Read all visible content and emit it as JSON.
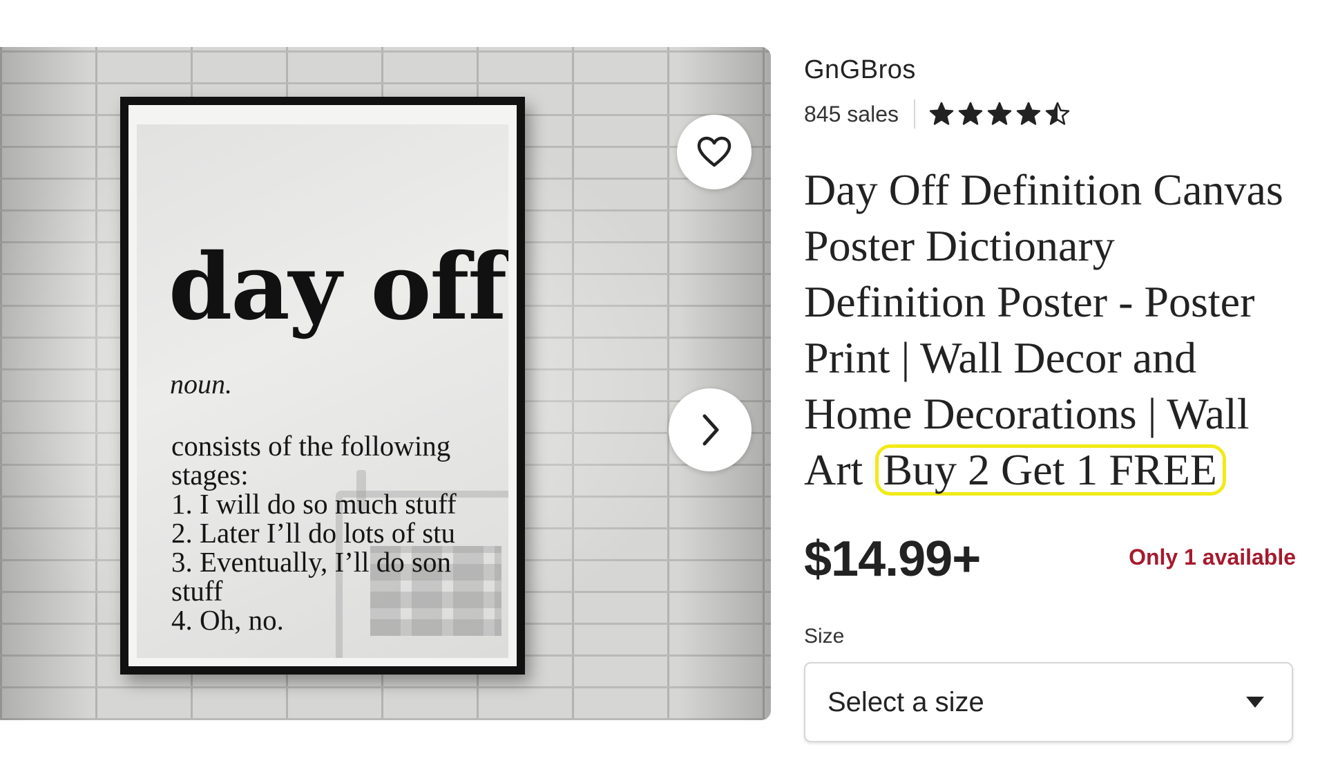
{
  "gallery": {
    "poster": {
      "headword": "day  off",
      "part_of_speech": "noun.",
      "definition_lines": [
        "consists of the following",
        "stages:",
        "1. I will do so much stuff",
        "2. Later I’ll do lots of stu",
        "3. Eventually, I’ll do son",
        "stuff",
        "4. Oh, no."
      ]
    },
    "favorite_icon": "heart-outline-icon",
    "next_icon": "chevron-right-icon"
  },
  "shop": {
    "name": "GnGBros",
    "sales": "845 sales",
    "rating": 4.5,
    "rating_max": 5,
    "star_color": "#222222"
  },
  "listing": {
    "title": "Day Off Definition Canvas Poster Dictionary Definition Poster - Poster Print | Wall Decor and Home Decorations | Wall Art",
    "promo": "Buy 2 Get 1 FREE",
    "promo_highlight_color": "#f2ea18",
    "price": "$14.99+",
    "availability": "Only 1 available",
    "availability_color": "#a61a2e"
  },
  "size_selector": {
    "label": "Size",
    "selected": "Select a size",
    "icon": "caret-down-icon"
  }
}
